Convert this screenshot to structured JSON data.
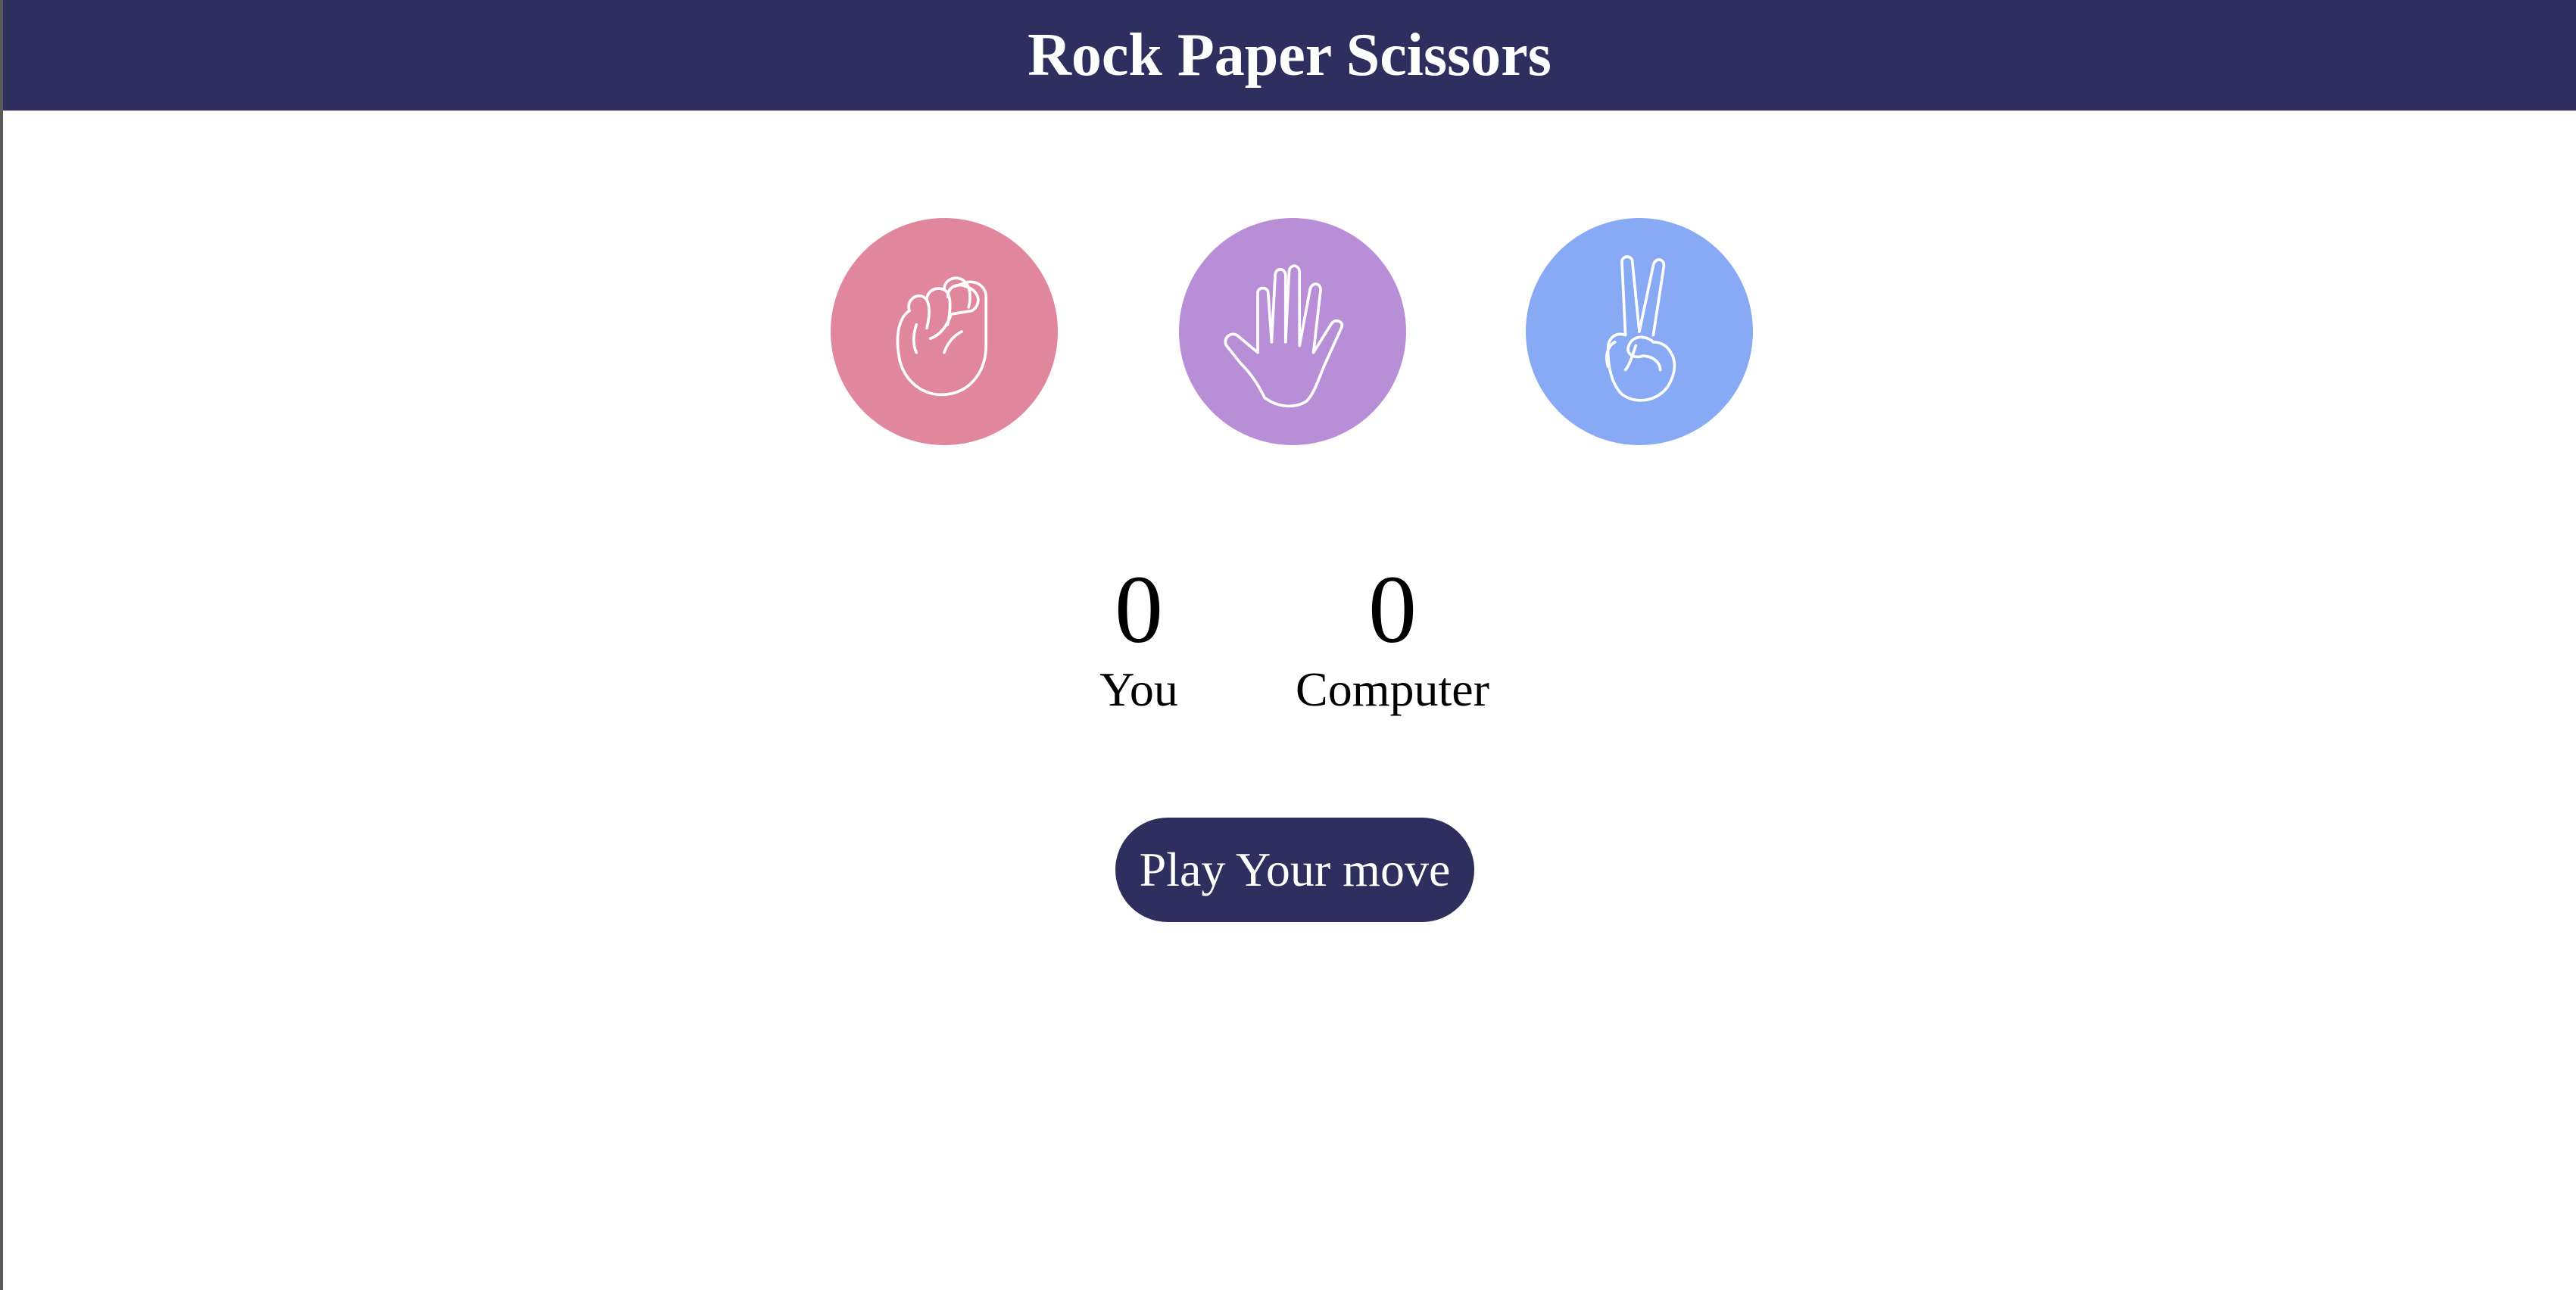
{
  "header": {
    "title": "Rock Paper Scissors"
  },
  "choices": [
    {
      "name": "rock",
      "icon": "rock-fist-icon",
      "color": "#e0879d"
    },
    {
      "name": "paper",
      "icon": "paper-hand-icon",
      "color": "#b88fd6"
    },
    {
      "name": "scissors",
      "icon": "scissors-peace-hand-icon",
      "color": "#88a9f4"
    }
  ],
  "scoreboard": {
    "you": {
      "score": "0",
      "label": "You"
    },
    "computer": {
      "score": "0",
      "label": "Computer"
    }
  },
  "play_button": {
    "label": "Play Your move",
    "color": "#2f2f5f"
  },
  "colors": {
    "header_bg": "#2f2f5f",
    "text": "#000000",
    "background": "#ffffff"
  }
}
